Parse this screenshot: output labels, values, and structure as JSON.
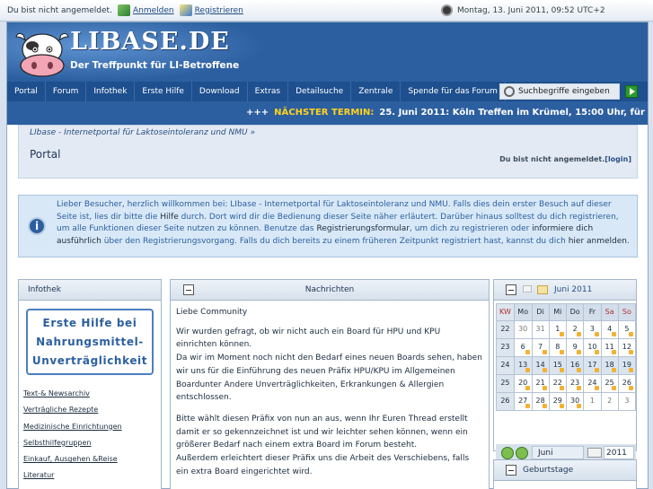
{
  "topbar": {
    "status": "Du bist nicht angemeldet.",
    "login": "Anmelden",
    "register": "Registrieren",
    "datetime": "Montag, 13. Juni 2011, 09:52 UTC+2"
  },
  "header": {
    "logo": "LIBASE.DE",
    "tagline": "Der Treffpunkt für LI-Betroffene"
  },
  "nav": {
    "items": [
      "Portal",
      "Forum",
      "Infothek",
      "Erste Hilfe",
      "Download",
      "Extras",
      "Detailsuche",
      "Zentrale",
      "Spende für das Forum"
    ],
    "search_placeholder": "Suchbegriffe eingeben"
  },
  "ticker": {
    "prefix": "+++",
    "label": "NÄCHSTER TERMIN:",
    "text": "25. Juni 2011: Köln Treffen im Krümel, 15:00 Uhr, für we"
  },
  "breadcrumb": {
    "link": "LIbase - Internetportal für Laktoseintoleranz und NMU",
    "sep": "»"
  },
  "page": {
    "title": "Portal",
    "status": "Du bist nicht angemeldet.",
    "login_link": "[login]"
  },
  "welcome": {
    "p1": "Lieber Besucher, herzlich willkommen bei: LIbase - Internetportal für Laktoseintoleranz und NMU. Falls dies dein erster Besuch auf dieser Seite ist, lies dir bitte die ",
    "help": "Hilfe",
    "p2": " durch. Dort wird dir die Bedienung dieser Seite näher erläutert. Darüber hinaus solltest du dich registrieren, um alle Funktionen dieser Seite nutzen zu können. Benutze das ",
    "form": "Registrierungsformular",
    "p3": ", um dich zu registrieren oder ",
    "more": "informiere dich ausführlich",
    "p4": " über den Registrierungsvorgang. Falls du dich bereits zu einem früheren Zeitpunkt registriert hast, kannst du dich ",
    "here": "hier anmelden",
    "p5": "."
  },
  "infothek": {
    "title": "Infothek",
    "button": "Erste Hilfe bei Nahrungsmittel-Unverträglichkeit",
    "links": [
      "Text-& Newsarchiv",
      "Verträgliche Rezepte",
      "Medizinische Einrichtungen",
      "Selbsthilfegruppen",
      "Einkauf, Ausgehen &Reise",
      "Literatur"
    ]
  },
  "news": {
    "title": "Nachrichten",
    "greeting": "Liebe Community",
    "para1": "Wir wurden gefragt, ob wir nicht auch ein Board für HPU und KPU einrichten können.",
    "para2a": "Da wir im Moment noch nicht den Bedarf eines neuen Boards sehen, haben wir uns für die Einführung des neuen Präfix HPU/KPU im ",
    "link1": "Allgemeinen Board",
    "para2b": "unter ",
    "link2": "Andere Unverträglichkeiten, Erkrankungen & Allergien",
    "para2c": " entschlossen.",
    "para3": "Bitte wählt diesen Präfix von nun an aus, wenn Ihr Euren Thread erstellt damit er so gekennzeichnet ist und wir leichter sehen können, wenn ein größerer Bedarf nach einem extra Board im Forum besteht.",
    "para4": "Außerdem erleichtert dieser Präfix uns die Arbeit des Verschiebens, falls ein extra Board eingerichtet wird."
  },
  "calendar": {
    "title": "Juni 2011",
    "headers": [
      "KW",
      "Mo",
      "Di",
      "Mi",
      "Do",
      "Fr",
      "Sa",
      "So"
    ],
    "weeks": [
      [
        "22",
        "30",
        "31",
        "1",
        "2",
        "3",
        "4",
        "5"
      ],
      [
        "23",
        "6",
        "7",
        "8",
        "9",
        "10",
        "11",
        "12"
      ],
      [
        "24",
        "13",
        "14",
        "15",
        "16",
        "17",
        "18",
        "19"
      ],
      [
        "25",
        "20",
        "21",
        "22",
        "23",
        "24",
        "25",
        "26"
      ],
      [
        "26",
        "27",
        "28",
        "29",
        "30",
        "1",
        "2",
        "3"
      ]
    ],
    "month_select": "Juni",
    "year_value": "2011"
  },
  "birthday": {
    "title": "Geburtstage"
  }
}
